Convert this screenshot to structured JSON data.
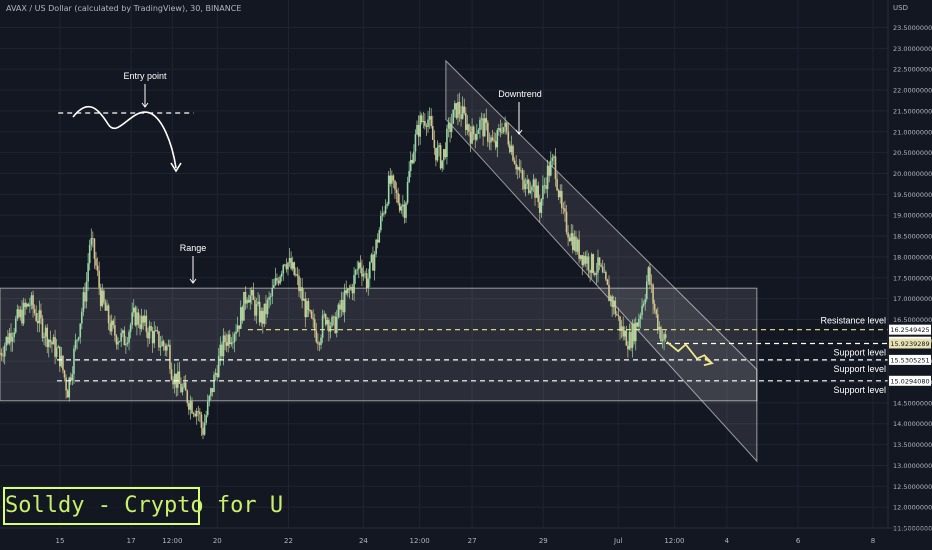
{
  "header": {
    "title": "AVAX / US Dollar (calculated by TradingView), 30, BINANCE",
    "currency": "USD"
  },
  "branding": {
    "text": "Solldy - Crypto for U"
  },
  "colors": {
    "background": "#131722",
    "grid": "#1f2430",
    "candle_up": "#9cd9a9",
    "candle_down": "#d4c48f",
    "text": "#b2b5be",
    "annotation_text": "#ffffff",
    "level_line": "#f0e68c",
    "brand": "#c8f06c"
  },
  "chart_data": {
    "type": "candlestick",
    "title": "AVAX / US Dollar (calculated by TradingView), 30, BINANCE",
    "ylabel": "USD",
    "ylim": [
      11.5,
      24.0
    ],
    "y_ticks": [
      "11.5000000",
      "12.0000000",
      "12.5000000",
      "13.0000000",
      "13.5000000",
      "14.0000000",
      "14.5000000",
      "15.0000000",
      "15.5000000",
      "16.0000000",
      "16.5000000",
      "17.0000000",
      "17.5000000",
      "18.0000000",
      "18.5000000",
      "19.0000000",
      "19.5000000",
      "20.0000000",
      "20.5000000",
      "21.0000000",
      "21.5000000",
      "22.0000000",
      "22.5000000",
      "23.0000000",
      "23.5000000"
    ],
    "x_ticks": [
      {
        "label": "15",
        "t": 16
      },
      {
        "label": "17",
        "t": 35
      },
      {
        "label": "12:00",
        "t": 46
      },
      {
        "label": "20",
        "t": 58
      },
      {
        "label": "22",
        "t": 77
      },
      {
        "label": "24",
        "t": 97
      },
      {
        "label": "12:00",
        "t": 112
      },
      {
        "label": "27",
        "t": 126
      },
      {
        "label": "29",
        "t": 145
      },
      {
        "label": "Jul",
        "t": 165
      },
      {
        "label": "12:00",
        "t": 180
      },
      {
        "label": "4",
        "t": 194
      },
      {
        "label": "6",
        "t": 213
      },
      {
        "label": "8",
        "t": 233
      }
    ],
    "x_range": [
      0,
      237
    ],
    "grid": true,
    "price_path": [
      [
        0,
        15.7
      ],
      [
        4,
        16.4
      ],
      [
        8,
        16.9
      ],
      [
        12,
        16.2
      ],
      [
        16,
        15.6
      ],
      [
        18,
        14.8
      ],
      [
        20,
        15.8
      ],
      [
        23,
        17.3
      ],
      [
        24,
        18.4
      ],
      [
        25,
        18.1
      ],
      [
        27,
        17.0
      ],
      [
        30,
        16.2
      ],
      [
        33,
        16.0
      ],
      [
        36,
        16.6
      ],
      [
        39,
        16.3
      ],
      [
        42,
        16.0
      ],
      [
        45,
        15.8
      ],
      [
        46,
        15.2
      ],
      [
        48,
        14.9
      ],
      [
        51,
        14.5
      ],
      [
        53,
        14.3
      ],
      [
        54,
        13.8
      ],
      [
        56,
        14.6
      ],
      [
        58,
        15.4
      ],
      [
        60,
        16.0
      ],
      [
        62,
        16.2
      ],
      [
        64,
        16.5
      ],
      [
        66,
        17.2
      ],
      [
        68,
        16.8
      ],
      [
        70,
        16.5
      ],
      [
        73,
        17.2
      ],
      [
        76,
        18.0
      ],
      [
        79,
        17.5
      ],
      [
        81,
        16.9
      ],
      [
        83,
        16.4
      ],
      [
        85,
        16.1
      ],
      [
        87,
        16.6
      ],
      [
        89,
        16.3
      ],
      [
        91,
        16.8
      ],
      [
        94,
        17.3
      ],
      [
        96,
        17.9
      ],
      [
        98,
        17.4
      ],
      [
        100,
        18.1
      ],
      [
        102,
        19.0
      ],
      [
        104,
        19.8
      ],
      [
        106,
        19.4
      ],
      [
        108,
        19.2
      ],
      [
        110,
        20.5
      ],
      [
        112,
        21.2
      ],
      [
        114,
        21.4
      ],
      [
        116,
        20.6
      ],
      [
        118,
        20.3
      ],
      [
        120,
        21.1
      ],
      [
        122,
        21.6
      ],
      [
        124,
        21.3
      ],
      [
        126,
        20.9
      ],
      [
        128,
        21.2
      ],
      [
        130,
        21.0
      ],
      [
        132,
        20.6
      ],
      [
        134,
        21.2
      ],
      [
        136,
        20.8
      ],
      [
        138,
        20.2
      ],
      [
        140,
        19.6
      ],
      [
        142,
        19.9
      ],
      [
        144,
        19.2
      ],
      [
        146,
        20.0
      ],
      [
        148,
        20.3
      ],
      [
        150,
        19.0
      ],
      [
        152,
        18.6
      ],
      [
        154,
        18.2
      ],
      [
        156,
        18.0
      ],
      [
        158,
        17.8
      ],
      [
        160,
        17.7
      ],
      [
        162,
        17.2
      ],
      [
        164,
        16.8
      ],
      [
        166,
        16.2
      ],
      [
        168,
        16.0
      ],
      [
        170,
        16.4
      ],
      [
        172,
        17.1
      ],
      [
        173,
        17.6
      ],
      [
        175,
        16.6
      ],
      [
        177,
        16.0
      ],
      [
        178,
        15.96
      ]
    ],
    "projection_path": [
      [
        178,
        15.96
      ],
      [
        181,
        15.74
      ],
      [
        183,
        15.9
      ],
      [
        186,
        15.56
      ],
      [
        188,
        15.64
      ],
      [
        190,
        15.45
      ]
    ],
    "levels": [
      {
        "label": "Resistance level",
        "price": 16.2549425,
        "price_text": "16.2549425"
      },
      {
        "price": 15.9669819,
        "price_text": "15.9669819"
      },
      {
        "label": "Support level",
        "price": 15.9239289,
        "price_text": "15.9239289"
      },
      {
        "label": "Support level",
        "price": 15.5305251,
        "price_text": "15.5305251"
      },
      {
        "label": "Support level",
        "price": 15.029408,
        "price_text": "15.0294080"
      }
    ],
    "range_zone": {
      "label": "Range",
      "t_start": 0,
      "t_end": 202,
      "price_low": 14.55,
      "price_high": 17.25
    },
    "channel": {
      "label": "Downtrend",
      "upper": [
        [
          119,
          22.7
        ],
        [
          202,
          15.3
        ]
      ],
      "lower": [
        [
          119,
          21.3
        ],
        [
          202,
          13.1
        ]
      ]
    },
    "entry_point": {
      "label": "Entry point",
      "price": 21.45,
      "t_start": 15,
      "t_end": 49
    }
  }
}
